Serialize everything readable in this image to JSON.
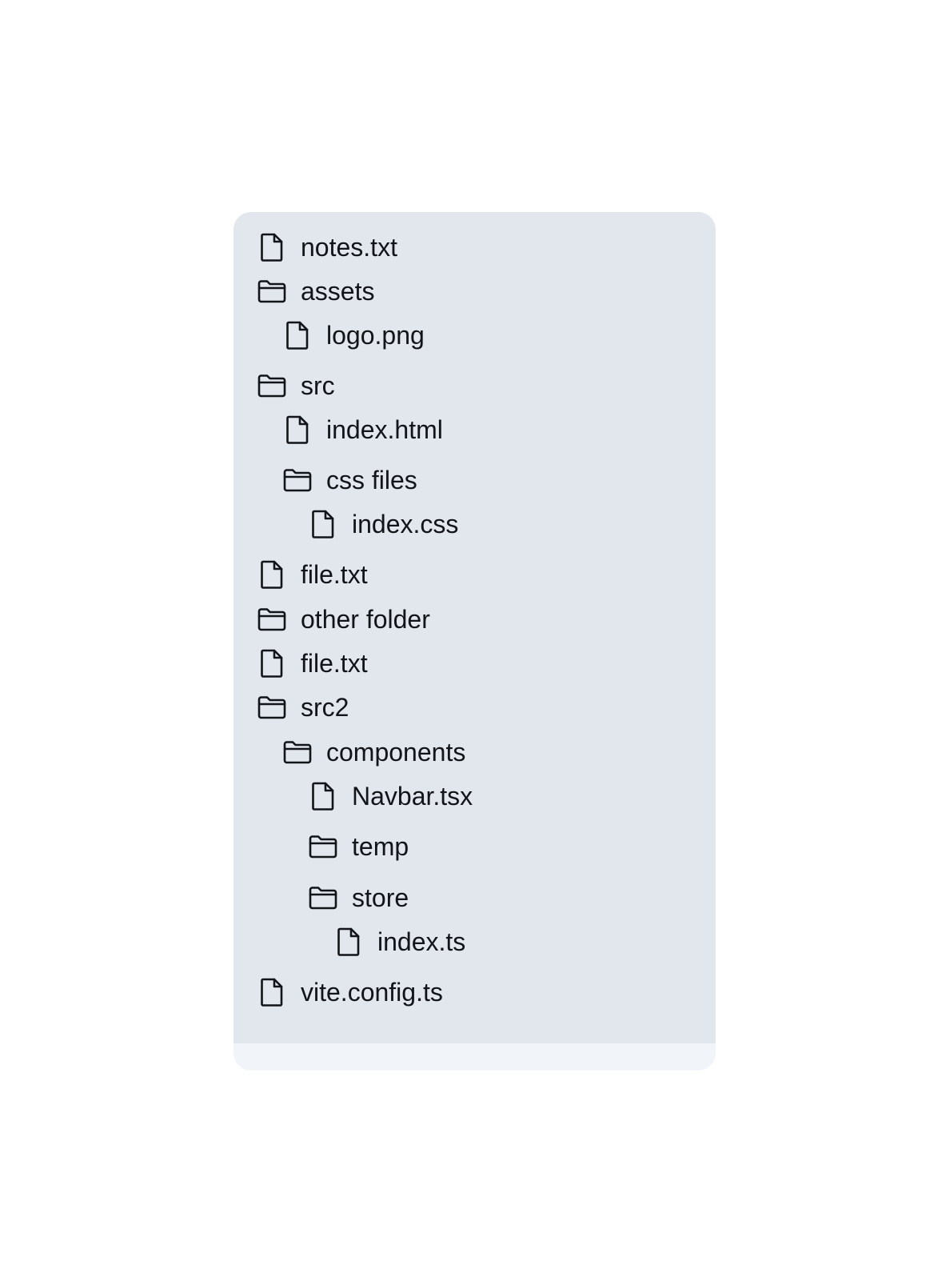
{
  "tree": {
    "items": [
      {
        "type": "file",
        "icon": "file-icon",
        "label": "notes.txt",
        "depth": 0
      },
      {
        "type": "folder",
        "icon": "folder-icon",
        "label": "assets",
        "depth": 0
      },
      {
        "type": "file",
        "icon": "file-icon",
        "label": "logo.png",
        "depth": 1
      },
      {
        "type": "folder",
        "icon": "folder-icon",
        "label": "src",
        "depth": 0
      },
      {
        "type": "file",
        "icon": "file-icon",
        "label": "index.html",
        "depth": 1
      },
      {
        "type": "folder",
        "icon": "folder-icon",
        "label": "css files",
        "depth": 1
      },
      {
        "type": "file",
        "icon": "file-icon",
        "label": "index.css",
        "depth": 2
      },
      {
        "type": "file",
        "icon": "file-icon",
        "label": "file.txt",
        "depth": 0
      },
      {
        "type": "folder",
        "icon": "folder-icon",
        "label": "other folder",
        "depth": 0
      },
      {
        "type": "file",
        "icon": "file-icon",
        "label": "file.txt",
        "depth": 0
      },
      {
        "type": "folder",
        "icon": "folder-icon",
        "label": "src2",
        "depth": 0
      },
      {
        "type": "folder",
        "icon": "folder-icon",
        "label": "components",
        "depth": 1
      },
      {
        "type": "file",
        "icon": "file-icon",
        "label": "Navbar.tsx",
        "depth": 2
      },
      {
        "type": "folder",
        "icon": "folder-icon",
        "label": "temp",
        "depth": 2
      },
      {
        "type": "folder",
        "icon": "folder-icon",
        "label": "store",
        "depth": 2
      },
      {
        "type": "file",
        "icon": "file-icon",
        "label": "index.ts",
        "depth": 3
      },
      {
        "type": "file",
        "icon": "file-icon",
        "label": "vite.config.ts",
        "depth": 0
      }
    ]
  },
  "colors": {
    "tree_background": "#e2e7ed",
    "panel_background": "#f1f4f8",
    "text": "#111418",
    "icon_stroke": "#111418"
  }
}
